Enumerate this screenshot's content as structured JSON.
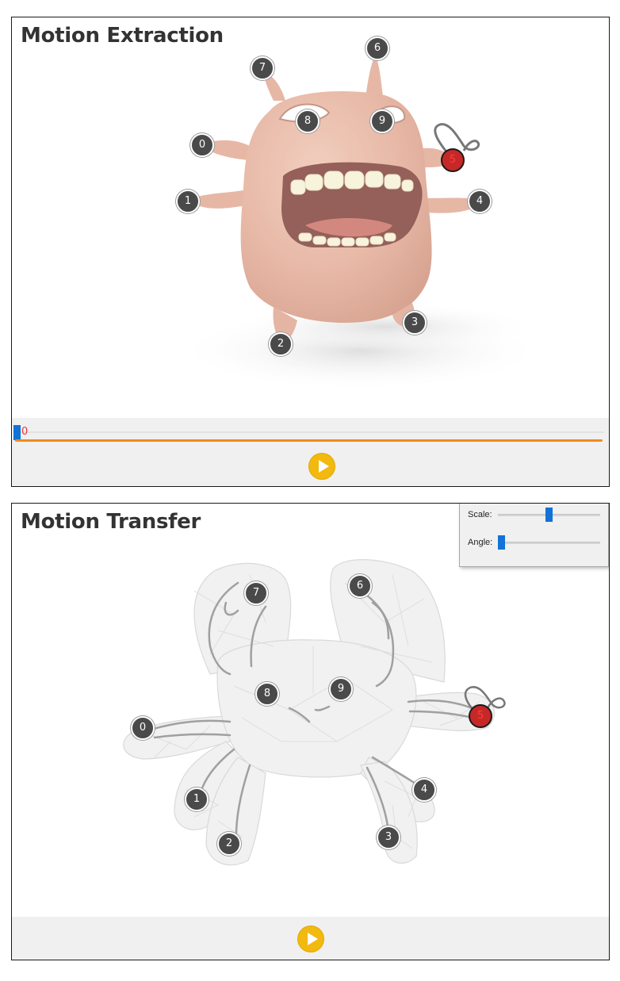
{
  "top_panel": {
    "title": "Motion Extraction",
    "frame_index": "0",
    "play_icon": "play-icon",
    "active_keypoint": "5"
  },
  "bottom_panel": {
    "title": "Motion Transfer",
    "scale_label": "Scale:",
    "angle_label": "Angle:",
    "scale_value": 0.5,
    "angle_value": 0.0,
    "play_icon": "play-icon",
    "active_keypoint": "5"
  },
  "keypoint_labels": [
    "0",
    "1",
    "2",
    "3",
    "4",
    "5",
    "6",
    "7",
    "8",
    "9"
  ],
  "colors": {
    "keypoint": "#4a4a4a",
    "active_keypoint": "#c62828",
    "timeline": "#f08c1a",
    "play_button": "#f2b90f",
    "slider_thumb": "#1272d6"
  }
}
